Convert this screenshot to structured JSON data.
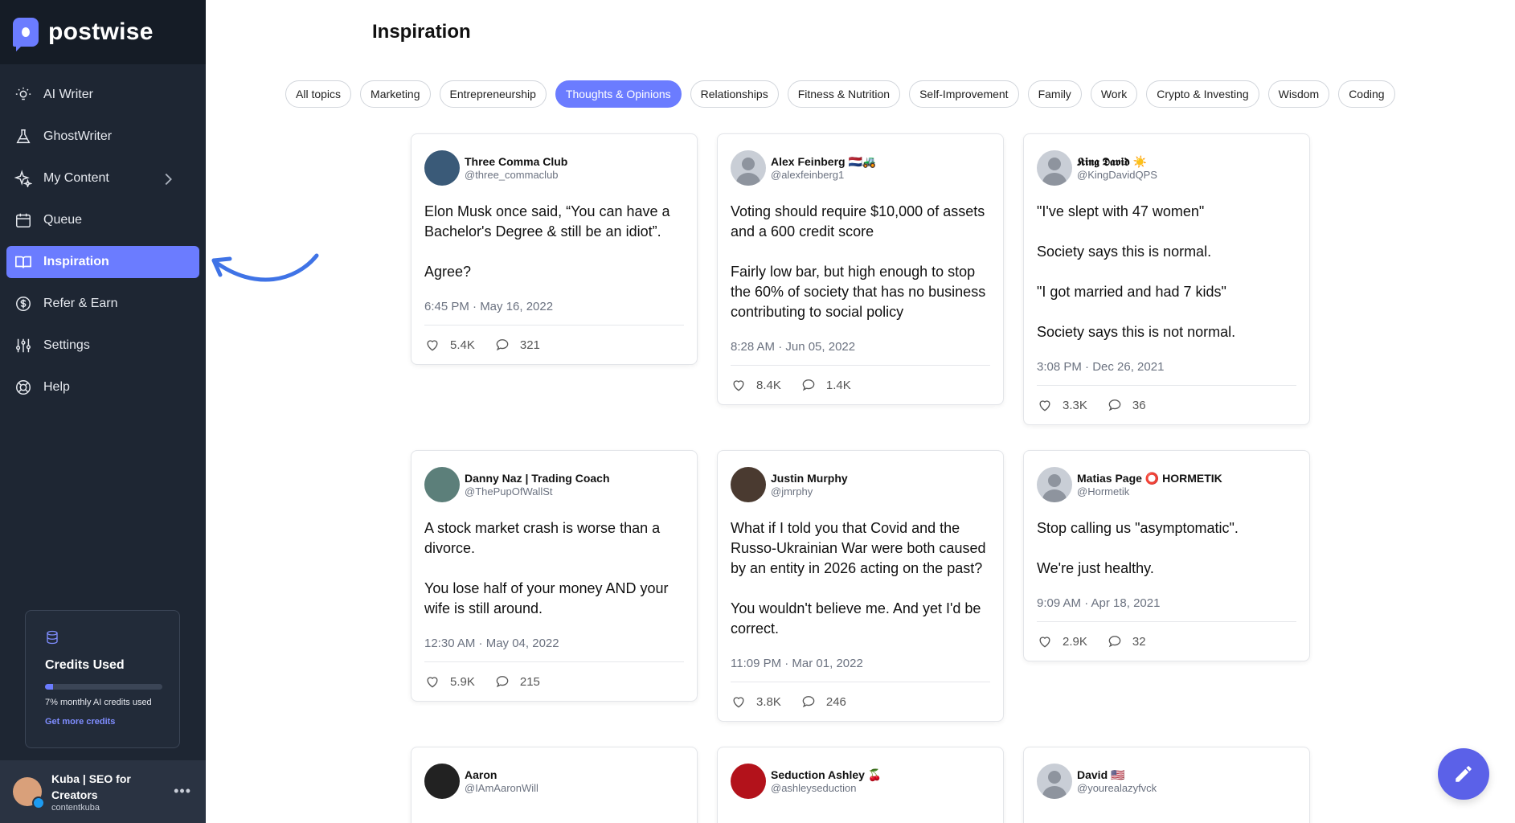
{
  "brand": {
    "name": "postwise"
  },
  "sidebar": {
    "items": [
      {
        "label": "AI Writer",
        "icon": "bulb-icon"
      },
      {
        "label": "GhostWriter",
        "icon": "flask-icon"
      },
      {
        "label": "My Content",
        "icon": "sparkle-icon"
      },
      {
        "label": "Queue",
        "icon": "calendar-icon"
      },
      {
        "label": "Inspiration",
        "icon": "book-icon"
      },
      {
        "label": "Refer & Earn",
        "icon": "dollar-icon"
      },
      {
        "label": "Settings",
        "icon": "sliders-icon"
      },
      {
        "label": "Help",
        "icon": "lifebuoy-icon"
      }
    ],
    "active": "Inspiration"
  },
  "credits": {
    "title": "Credits Used",
    "percent": 7,
    "text": "7% monthly AI credits used",
    "link": "Get more credits"
  },
  "user": {
    "name": "Kuba | SEO for Creators",
    "handle": "contentkuba"
  },
  "page": {
    "title": "Inspiration"
  },
  "topics": [
    "All topics",
    "Marketing",
    "Entrepreneurship",
    "Thoughts & Opinions",
    "Relationships",
    "Fitness & Nutrition",
    "Self-Improvement",
    "Family",
    "Work",
    "Crypto & Investing",
    "Wisdom",
    "Coding"
  ],
  "active_topic": "Thoughts & Opinions",
  "tweets": [
    {
      "name": "Three Comma Club",
      "handle": "@three_commaclub",
      "p1": "Elon Musk once said, “You can have a Bachelor's Degree & still be an idiot”.",
      "p2": "Agree?",
      "time": "6:45 PM · May 16, 2022",
      "likes": "5.4K",
      "replies": "321"
    },
    {
      "name": "Alex Feinberg 🇳🇱🚜",
      "handle": "@alexfeinberg1",
      "p1": "Voting should require $10,000 of assets and a 600 credit score",
      "p2": "Fairly low bar, but high enough to stop the 60% of society that has no business contributing to social policy",
      "time": "8:28 AM · Jun 05, 2022",
      "likes": "8.4K",
      "replies": "1.4K"
    },
    {
      "name": "𝕶𝖎𝖓𝖌 𝕯𝖆𝖛𝖎𝖉 ☀️",
      "handle": "@KingDavidQPS",
      "p1": "\"I've slept with 47 women\"",
      "p2": "Society says this is normal.",
      "p3": "\"I got married and had 7 kids\"",
      "p4": "Society says this is not normal.",
      "time": "3:08 PM · Dec 26, 2021",
      "likes": "3.3K",
      "replies": "36"
    },
    {
      "name": "Danny Naz | Trading Coach",
      "handle": "@ThePupOfWallSt",
      "p1": "A stock market crash is worse than a divorce.",
      "p2": "You lose half of your money AND your wife is still around.",
      "time": "12:30 AM · May 04, 2022",
      "likes": "5.9K",
      "replies": "215"
    },
    {
      "name": "Justin Murphy",
      "handle": "@jmrphy",
      "p1": "What if I told you that Covid and the Russo-Ukrainian War were both caused by an entity in 2026 acting on the past?",
      "p2": "You wouldn't believe me. And yet I'd be correct.",
      "time": "11:09 PM · Mar 01, 2022",
      "likes": "3.8K",
      "replies": "246"
    },
    {
      "name": "Matias Page ⭕ HORMETIK",
      "handle": "@Hormetik",
      "p1": "Stop calling us \"asymptomatic\".",
      "p2": "We're just healthy.",
      "time": "9:09 AM · Apr 18, 2021",
      "likes": "2.9K",
      "replies": "32"
    },
    {
      "name": "Aaron",
      "handle": "@IAmAaronWill"
    },
    {
      "name": "Seduction Ashley 🍒",
      "handle": "@ashleyseduction"
    },
    {
      "name": "David 🇺🇸",
      "handle": "@yourealazyfvck"
    }
  ],
  "colors": {
    "accent": "#6b7cff",
    "sidebar": "#1e2633"
  }
}
